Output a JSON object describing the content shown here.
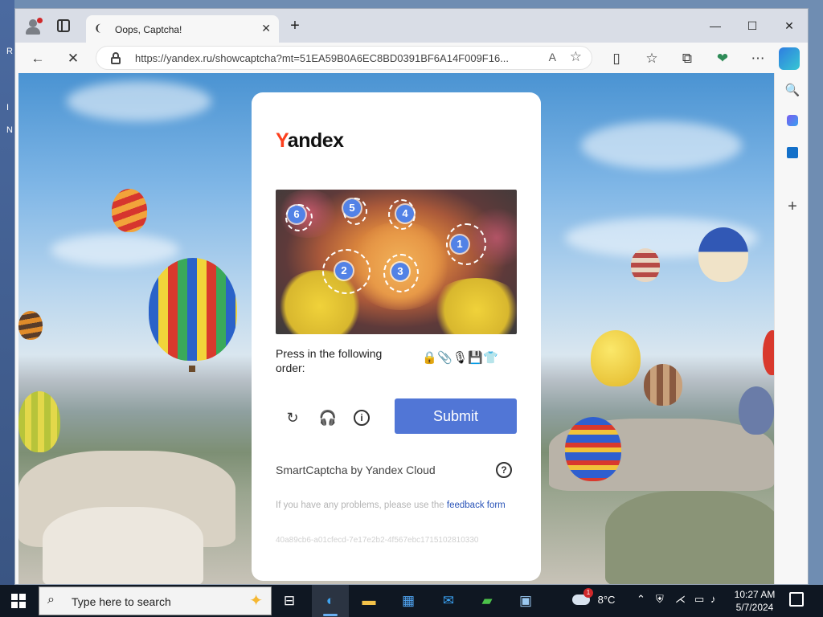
{
  "desktop": {
    "edge_chars": [
      "R",
      "I",
      "N"
    ]
  },
  "browser": {
    "tab": {
      "title": "Oops, Captcha!",
      "favicon": "loading-icon",
      "close_glyph": "✕"
    },
    "new_tab_glyph": "+",
    "window_controls": {
      "minimize": "—",
      "maximize": "☐",
      "close": "✕"
    },
    "address": {
      "url": "https://yandex.ru/showcaptcha?mt=51EA59B0A6EC8BD0391BF6A14F009F16..."
    },
    "toolbar": {
      "back": "←",
      "stop": "✕",
      "read_aloud": "A",
      "favorite": "☆",
      "split": "▯",
      "favorites": "☆",
      "collections": "⧉",
      "performance": "❤",
      "more": "⋯"
    },
    "sidebar": {
      "search": "🔍",
      "add": "+"
    }
  },
  "captcha": {
    "logo": {
      "first_letter": "Y",
      "rest": "andex"
    },
    "instruction": "Press in the following order:",
    "order_icons": [
      "lock-icon",
      "paperclip-icon",
      "microphone-icon",
      "floppy-disk-icon",
      "tshirt-icon"
    ],
    "order_glyphs": [
      "🔒",
      "📎",
      "🎙",
      "💾",
      "👕"
    ],
    "markers": [
      "1",
      "2",
      "3",
      "4",
      "5",
      "6"
    ],
    "refresh_glyph": "↻",
    "audio_glyph": "🎧",
    "info_glyph": "i",
    "submit_label": "Submit",
    "brand_text": "SmartCaptcha by Yandex Cloud",
    "help_glyph": "?",
    "problems_text": "If you have any problems, please use the ",
    "feedback_link": "feedback form",
    "token": "40a89cb6-a01cfecd-7e17e2b2-4f567ebc1715102810330"
  },
  "taskbar": {
    "search_placeholder": "Type here to search",
    "weather": {
      "temp": "8°C",
      "badge": "1"
    },
    "clock": {
      "time": "10:27 AM",
      "date": "5/7/2024"
    }
  }
}
